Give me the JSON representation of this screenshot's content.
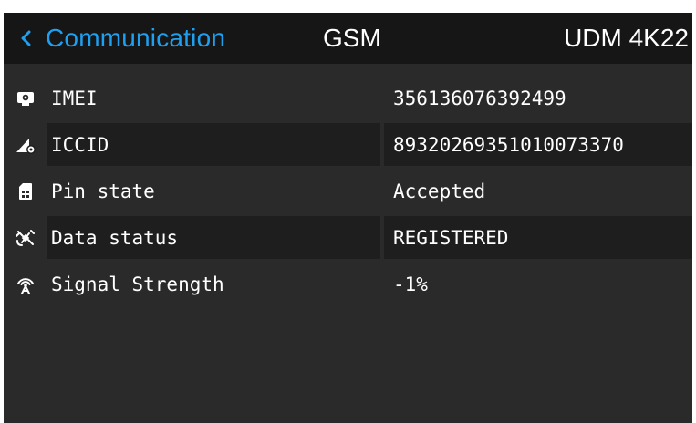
{
  "header": {
    "back_label": "Communication",
    "section_title": "GSM",
    "device_name": "UDM 4K22"
  },
  "rows": [
    {
      "icon": "device-id-icon",
      "label": "IMEI",
      "value": "356136076392499"
    },
    {
      "icon": "sim-settings-icon",
      "label": "ICCID",
      "value": "89320269351010073370"
    },
    {
      "icon": "sim-card-icon",
      "label": "Pin state",
      "value": "Accepted"
    },
    {
      "icon": "satellite-icon",
      "label": "Data status",
      "value": "REGISTERED"
    },
    {
      "icon": "antenna-signal-icon",
      "label": "Signal Strength",
      "value": "-1%"
    }
  ],
  "colors": {
    "accent": "#1f9ff0",
    "header_bg": "#161616",
    "panel_bg": "#2a2a2a",
    "row_alt_bg": "#1e1e1e",
    "text": "#ffffff"
  }
}
